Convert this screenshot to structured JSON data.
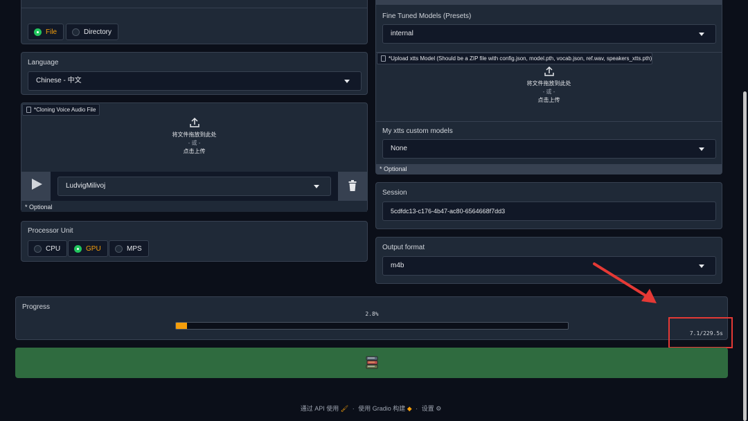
{
  "source_tabs": {
    "options": [
      {
        "label": "File",
        "selected": true
      },
      {
        "label": "Directory",
        "selected": false
      }
    ]
  },
  "language": {
    "label": "Language",
    "value": "Chinese - 中文"
  },
  "cloning_voice": {
    "file_label": "*Cloning Voice Audio File",
    "upload_line1": "将文件拖放到此处",
    "upload_line2": "- 或 -",
    "upload_line3": "点击上传",
    "voice_value": "LudvigMilivoj",
    "optional": "* Optional"
  },
  "processor": {
    "label": "Processor Unit",
    "options": [
      {
        "label": "CPU",
        "selected": false
      },
      {
        "label": "GPU",
        "selected": true
      },
      {
        "label": "MPS",
        "selected": false
      }
    ]
  },
  "fine_tuned": {
    "label": "Fine Tuned Models (Presets)",
    "value": "internal",
    "upload_label": "*Upload xtts Model (Should be a ZIP file with config.json, model.pth, vocab.json, ref.wav, speakers_xtts.pth)",
    "upload_line1": "将文件拖放到此处",
    "upload_line2": "- 或 -",
    "upload_line3": "点击上传"
  },
  "custom_models": {
    "label": "My xtts custom models",
    "value": "None",
    "optional": "* Optional"
  },
  "session": {
    "label": "Session",
    "value": "5cdfdc13-c176-4b47-ac80-6564668f7dd3"
  },
  "output_format": {
    "label": "Output format",
    "value": "m4b"
  },
  "progress": {
    "label": "Progress",
    "percent_text": "2.8%",
    "fraction": 0.028,
    "time_text": "7.1/229.5s"
  },
  "convert_button": {
    "icon": "books-icon"
  },
  "footer": {
    "api_text": "通过 API 使用",
    "sep1": "·",
    "gradio_text": "使用 Gradio 构建",
    "sep2": "·",
    "settings_text": "设置"
  },
  "colors": {
    "accent": "#f59e0b",
    "radio_on": "#22c55e",
    "button": "#2f6b3f",
    "annotation": "#e53935"
  }
}
